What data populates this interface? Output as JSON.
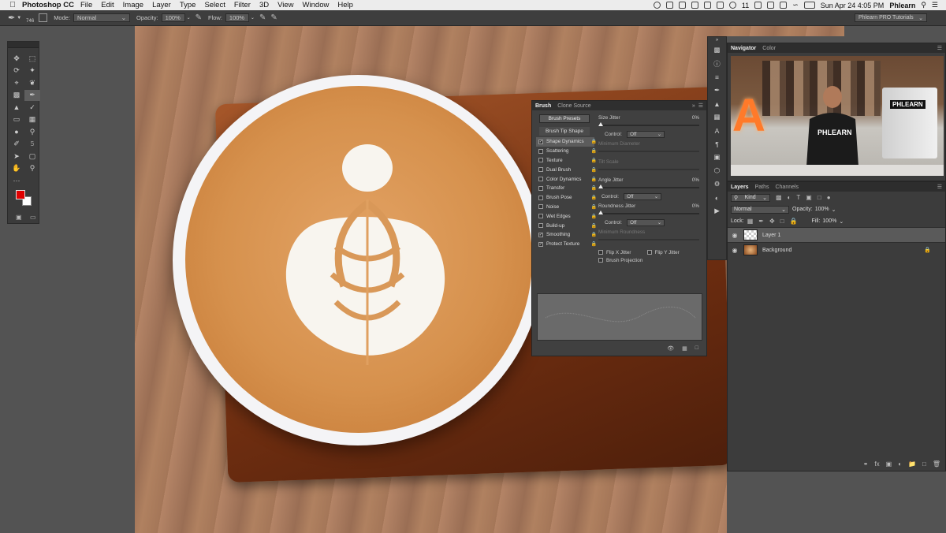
{
  "menubar": {
    "app": "Photoshop CC",
    "items": [
      "File",
      "Edit",
      "Image",
      "Layer",
      "Type",
      "Select",
      "Filter",
      "3D",
      "View",
      "Window",
      "Help"
    ],
    "datetime": "Sun Apr 24  4:05 PM",
    "user": "Phlearn",
    "battery": "11"
  },
  "options": {
    "brush_size": "746",
    "mode_label": "Mode:",
    "mode_value": "Normal",
    "opacity_label": "Opacity:",
    "opacity_value": "100%",
    "flow_label": "Flow:",
    "flow_value": "100%",
    "workspace": "Phlearn PRO Tutorials"
  },
  "brush_panel": {
    "tabs": [
      "Brush",
      "Clone Source"
    ],
    "presets_button": "Brush Presets",
    "tip_shape": "Brush Tip Shape",
    "items": [
      {
        "label": "Shape Dynamics",
        "checked": true,
        "active": true
      },
      {
        "label": "Scattering",
        "checked": false
      },
      {
        "label": "Texture",
        "checked": false
      },
      {
        "label": "Dual Brush",
        "checked": false
      },
      {
        "label": "Color Dynamics",
        "checked": false
      },
      {
        "label": "Transfer",
        "checked": false
      },
      {
        "label": "Brush Pose",
        "checked": false
      },
      {
        "label": "Noise",
        "checked": false
      },
      {
        "label": "Wet Edges",
        "checked": false
      },
      {
        "label": "Build-up",
        "checked": false
      },
      {
        "label": "Smoothing",
        "checked": true
      },
      {
        "label": "Protect Texture",
        "checked": true
      }
    ],
    "size_jitter": {
      "label": "Size Jitter",
      "value": "0%"
    },
    "control_label": "Control:",
    "control_value": "Off",
    "min_diameter": "Minimum Diameter",
    "tilt_scale": "Tilt Scale",
    "angle_jitter": {
      "label": "Angle Jitter",
      "value": "0%"
    },
    "roundness_jitter": {
      "label": "Roundness Jitter",
      "value": "0%"
    },
    "min_roundness": "Minimum Roundness",
    "flip_x": "Flip X Jitter",
    "flip_y": "Flip Y Jitter",
    "brush_projection": "Brush Projection"
  },
  "navigator": {
    "tabs": [
      "Navigator",
      "Color"
    ],
    "logo_text": "PHLEARN",
    "shirt_text": "PHLEARN",
    "sign_letter": "A"
  },
  "layers_panel": {
    "tabs": [
      "Layers",
      "Paths",
      "Channels"
    ],
    "kind_label": "Kind",
    "blend_mode": "Normal",
    "opacity_label": "Opacity:",
    "opacity_value": "100%",
    "lock_label": "Lock:",
    "fill_label": "Fill:",
    "fill_value": "100%",
    "layers": [
      {
        "name": "Layer 1",
        "selected": true
      },
      {
        "name": "Background",
        "selected": false
      }
    ]
  },
  "colors": {
    "foreground": "#e00000",
    "background": "#ffffff"
  }
}
